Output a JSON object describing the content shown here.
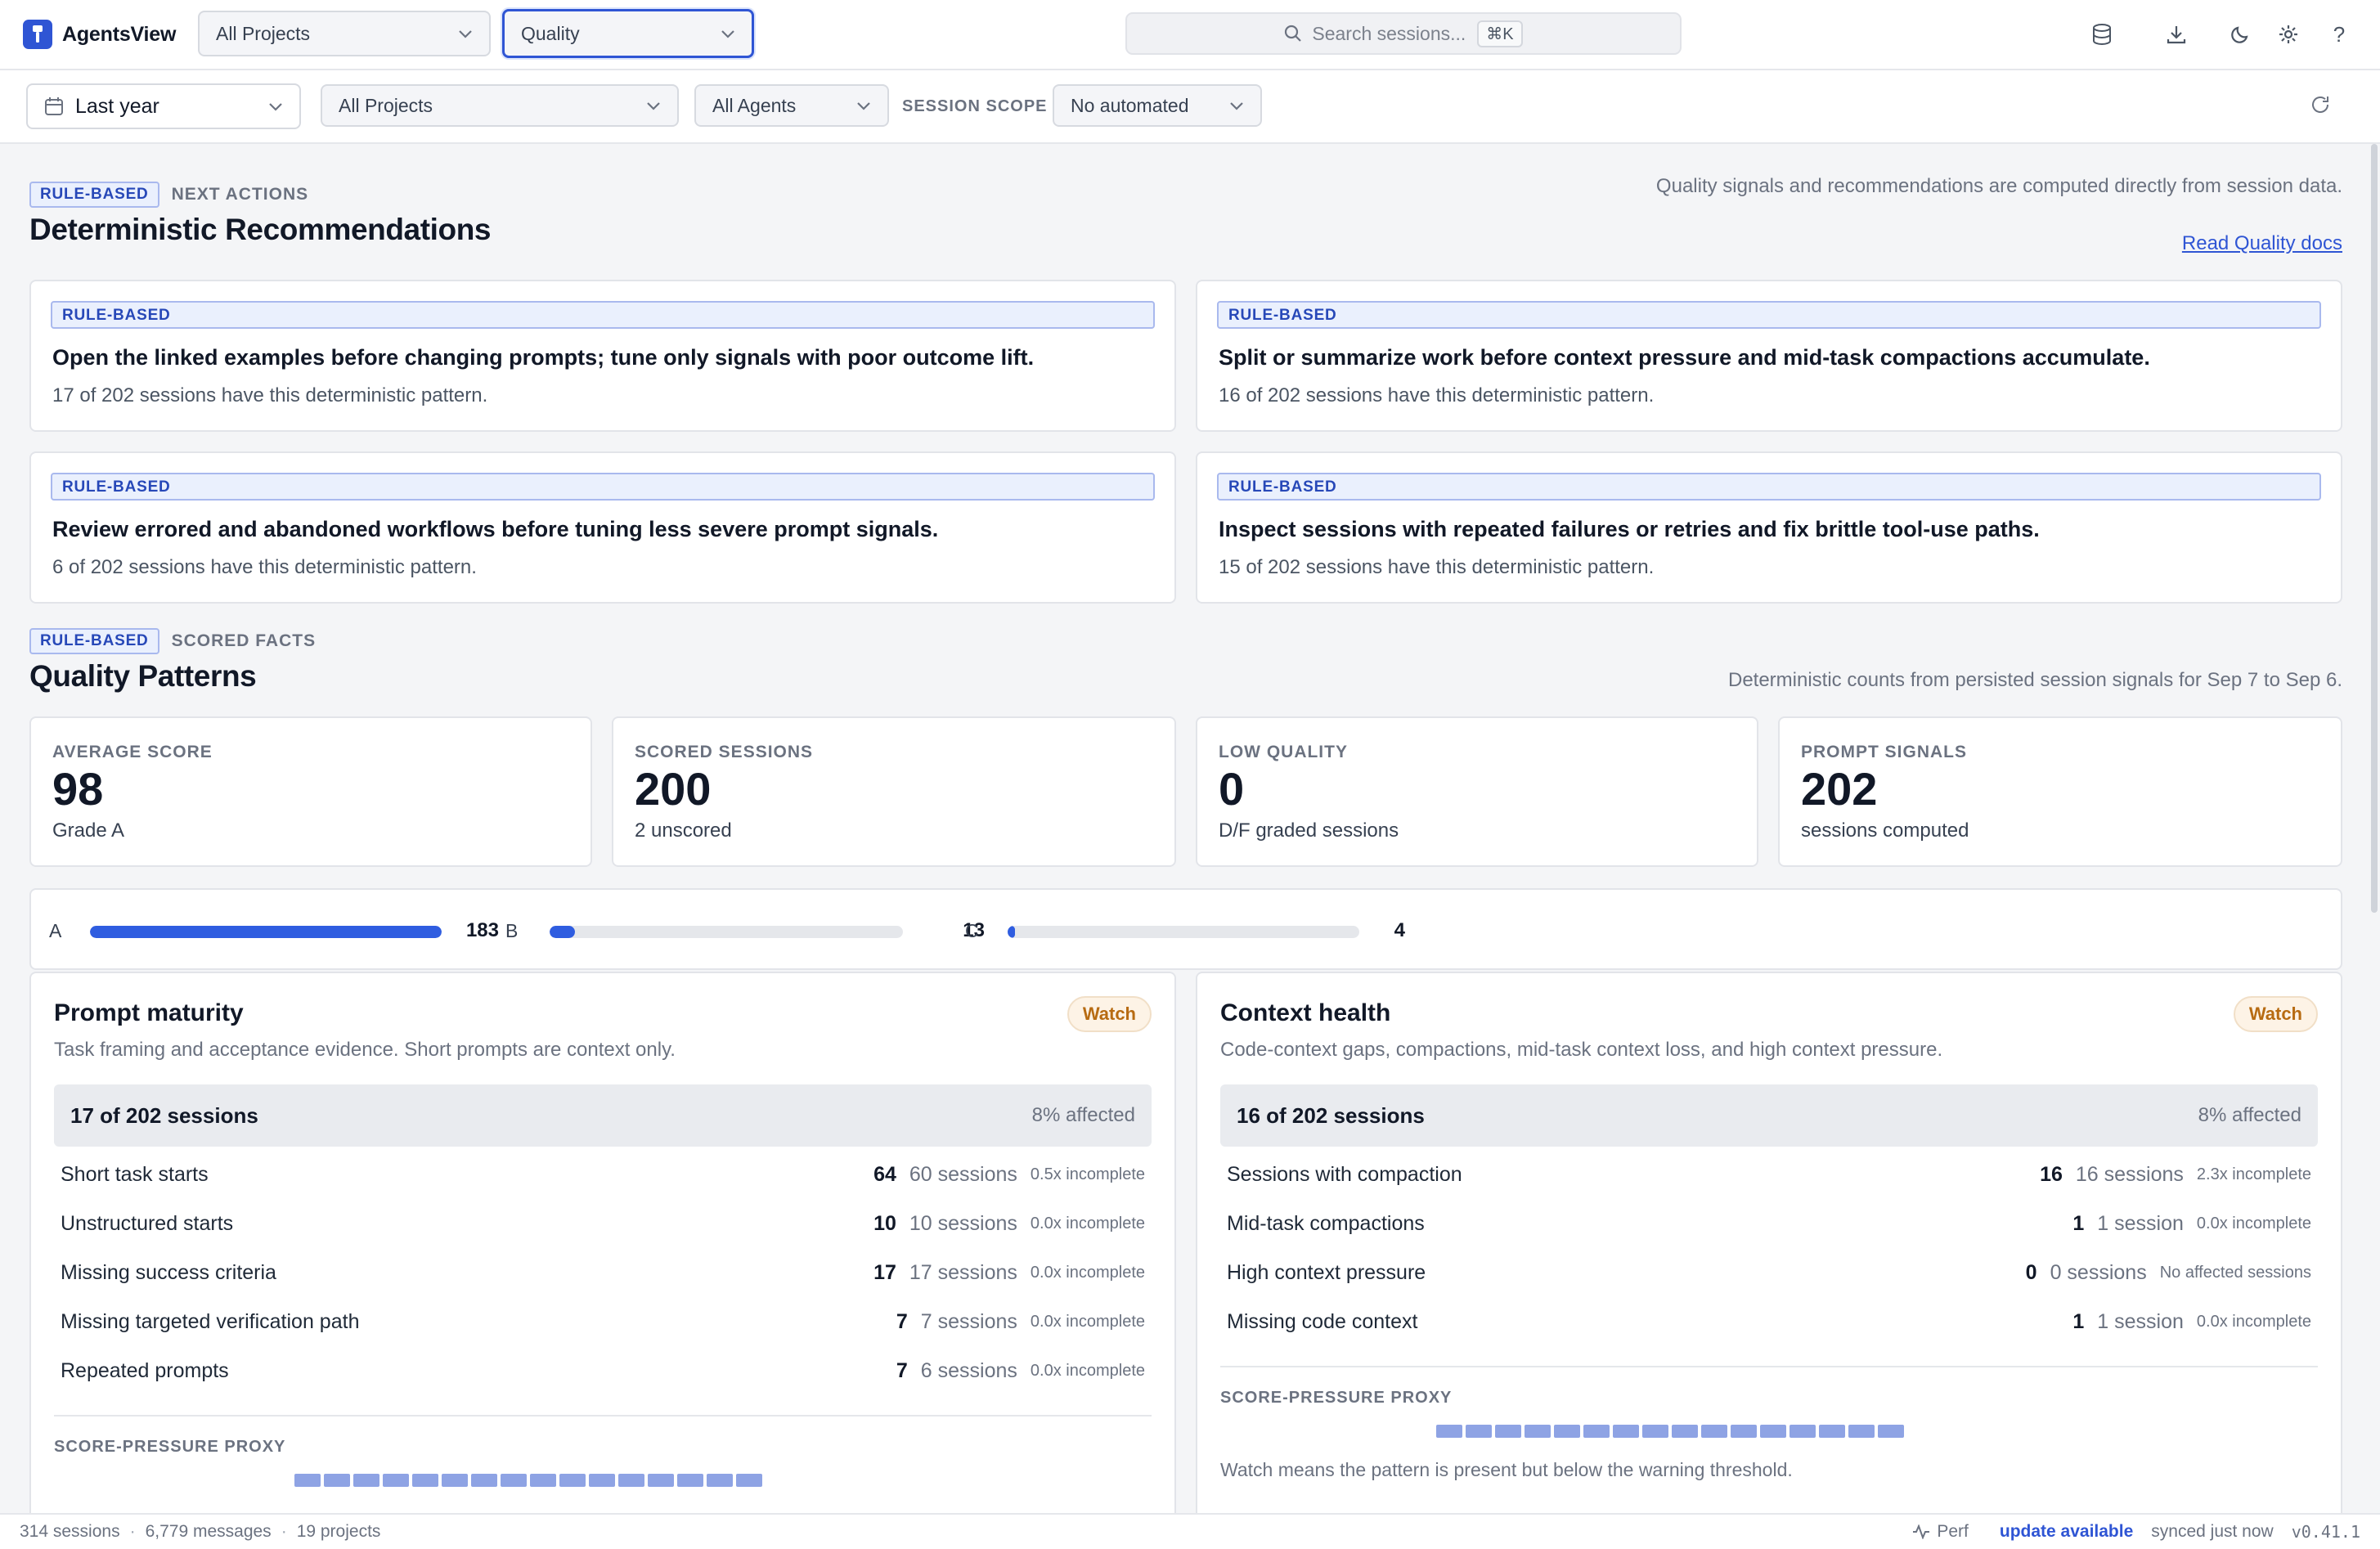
{
  "app": {
    "name": "AgentsView"
  },
  "topbar": {
    "project_select": "All Projects",
    "view_select": "Quality",
    "search_placeholder": "Search sessions...",
    "search_shortcut": "⌘K"
  },
  "filters": {
    "date_range": "Last year",
    "project": "All Projects",
    "agent": "All Agents",
    "session_scope_label": "SESSION SCOPE",
    "session_scope": "No automated"
  },
  "recommendations": {
    "tag": "RULE-BASED",
    "eyebrow": "NEXT ACTIONS",
    "title": "Deterministic Recommendations",
    "note": "Quality signals and recommendations are computed directly from session data.",
    "docs_link": "Read Quality docs",
    "cards": [
      {
        "tag": "RULE-BASED",
        "title": "Open the linked examples before changing prompts; tune only signals with poor outcome lift.",
        "subtitle": "17 of 202 sessions have this deterministic pattern."
      },
      {
        "tag": "RULE-BASED",
        "title": "Split or summarize work before context pressure and mid-task compactions accumulate.",
        "subtitle": "16 of 202 sessions have this deterministic pattern."
      },
      {
        "tag": "RULE-BASED",
        "title": "Review errored and abandoned workflows before tuning less severe prompt signals.",
        "subtitle": "6 of 202 sessions have this deterministic pattern."
      },
      {
        "tag": "RULE-BASED",
        "title": "Inspect sessions with repeated failures or retries and fix brittle tool-use paths.",
        "subtitle": "15 of 202 sessions have this deterministic pattern."
      }
    ]
  },
  "patterns": {
    "tag": "RULE-BASED",
    "eyebrow": "SCORED FACTS",
    "title": "Quality Patterns",
    "note": "Deterministic counts from persisted session signals for Sep 7 to Sep 6.",
    "stats": [
      {
        "label": "AVERAGE SCORE",
        "value": "98",
        "sub": "Grade A"
      },
      {
        "label": "SCORED SESSIONS",
        "value": "200",
        "sub": "2 unscored"
      },
      {
        "label": "LOW QUALITY",
        "value": "0",
        "sub": "D/F graded sessions"
      },
      {
        "label": "PROMPT SIGNALS",
        "value": "202",
        "sub": "sessions computed"
      }
    ],
    "grades": [
      {
        "letter": "A",
        "count": "183",
        "fraction": 1.0
      },
      {
        "letter": "B",
        "count": "13",
        "fraction": 0.071
      },
      {
        "letter": "C",
        "count": "4",
        "fraction": 0.022
      }
    ]
  },
  "panels": [
    {
      "title": "Prompt maturity",
      "badge": "Watch",
      "description": "Task framing and acceptance evidence. Short prompts are context only.",
      "summary": "17 of 202 sessions",
      "affected": "8% affected",
      "rows": [
        {
          "label": "Short task starts",
          "count": "64",
          "sessions": "60 sessions",
          "ratio": "0.5x incomplete"
        },
        {
          "label": "Unstructured starts",
          "count": "10",
          "sessions": "10 sessions",
          "ratio": "0.0x incomplete"
        },
        {
          "label": "Missing success criteria",
          "count": "17",
          "sessions": "17 sessions",
          "ratio": "0.0x incomplete"
        },
        {
          "label": "Missing targeted verification path",
          "count": "7",
          "sessions": "7 sessions",
          "ratio": "0.0x incomplete"
        },
        {
          "label": "Repeated prompts",
          "count": "7",
          "sessions": "6 sessions",
          "ratio": "0.0x incomplete"
        }
      ],
      "proxy_label": "SCORE-PRESSURE PROXY"
    },
    {
      "title": "Context health",
      "badge": "Watch",
      "description": "Code-context gaps, compactions, mid-task context loss, and high context pressure.",
      "summary": "16 of 202 sessions",
      "affected": "8% affected",
      "rows": [
        {
          "label": "Sessions with compaction",
          "count": "16",
          "sessions": "16 sessions",
          "ratio": "2.3x incomplete"
        },
        {
          "label": "Mid-task compactions",
          "count": "1",
          "sessions": "1 session",
          "ratio": "0.0x incomplete"
        },
        {
          "label": "High context pressure",
          "count": "0",
          "sessions": "0 sessions",
          "ratio": "No affected sessions"
        },
        {
          "label": "Missing code context",
          "count": "1",
          "sessions": "1 session",
          "ratio": "0.0x incomplete"
        }
      ],
      "proxy_label": "SCORE-PRESSURE PROXY",
      "footnote": "Watch means the pattern is present but below the warning threshold."
    }
  ],
  "statusbar": {
    "sessions": "314 sessions",
    "messages": "6,779 messages",
    "projects": "19 projects",
    "perf": "Perf",
    "update": "update available",
    "synced": "synced just now",
    "version": "v0.41.1"
  },
  "colors": {
    "accent": "#2f55d4",
    "tag_bg": "#eaf0fd",
    "watch": "#b76b12",
    "proxy": "#8ea3e4"
  }
}
